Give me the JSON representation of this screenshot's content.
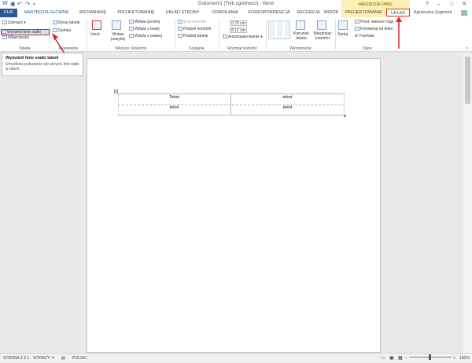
{
  "window": {
    "title": "Dokument1 [Tryb zgodności] - Word",
    "context_group": "NARZĘDZIA TABEL",
    "user": "Agnieszka Zygmunt"
  },
  "tabs": [
    "PLIK",
    "NARZĘDZIA GŁÓWNE",
    "WSTAWIANIE",
    "PROJEKTOWANIE",
    "UKŁAD STRONY",
    "ODWOŁANIA",
    "KORESPONDENCJA",
    "RECENZJA",
    "WIDOK",
    "PROJEKTOWANIE",
    "UKŁAD"
  ],
  "ribbon": {
    "tabela": {
      "label": "Tabela",
      "zaznacz": "Zaznacz",
      "wyswietl": "Wyświetl linie siatki",
      "wlasciwosci": "Właściwości"
    },
    "rysowanie": {
      "label": "Rysowanie",
      "rysuj": "Rysuj tabelę",
      "gumka": "Gumka"
    },
    "usun": "Usuń",
    "wiersze": {
      "label": "Wiersze i kolumny",
      "wstaw_powyzej_big": "Wstaw powyżej",
      "wstaw_ponizej": "Wstaw poniżej",
      "wstaw_z_lewej": "Wstaw z lewej",
      "wstaw_z_prawej": "Wstaw z prawej"
    },
    "scalanie": {
      "label": "Scalanie",
      "scal": "Scal komórki",
      "podziel_komorki": "Podziel komórki",
      "podziel_tabele": "Podziel tabelę"
    },
    "rozmiar": {
      "label": "Rozmiar komórki",
      "height": "0,79 cm",
      "width": "8,12 cm",
      "autodopasowanie": "Autodopasowanie"
    },
    "wyrownanie": {
      "label": "Wyrównanie",
      "kierunek": "Kierunek tekstu",
      "marginesy": "Marginesy komórki"
    },
    "dane": {
      "label": "Dane",
      "sortuj": "Sortuj",
      "powtorz": "Powt. wiersze nagł.",
      "konwertuj": "Konwertuj na tekst",
      "formula": "Formuła"
    }
  },
  "tooltip": {
    "title": "Wyświetl linie siatki tabeli",
    "body": "Umożliwia pokazanie lub ukrycie linii siatki w tabeli."
  },
  "table": {
    "rows": [
      [
        "Tekst",
        "tekst"
      ],
      [
        "tekst",
        "tekst"
      ]
    ]
  },
  "status": {
    "page": "STRONA 1 Z 1",
    "words": "WYRAZY: 4",
    "lang": "POLSKI",
    "zoom": "100%"
  },
  "colors": {
    "accent": "#2b579a",
    "highlight": "#e0262b"
  },
  "icons": {
    "save": "save-icon",
    "undo": "undo-icon",
    "redo": "redo-icon",
    "help": "help-icon"
  }
}
